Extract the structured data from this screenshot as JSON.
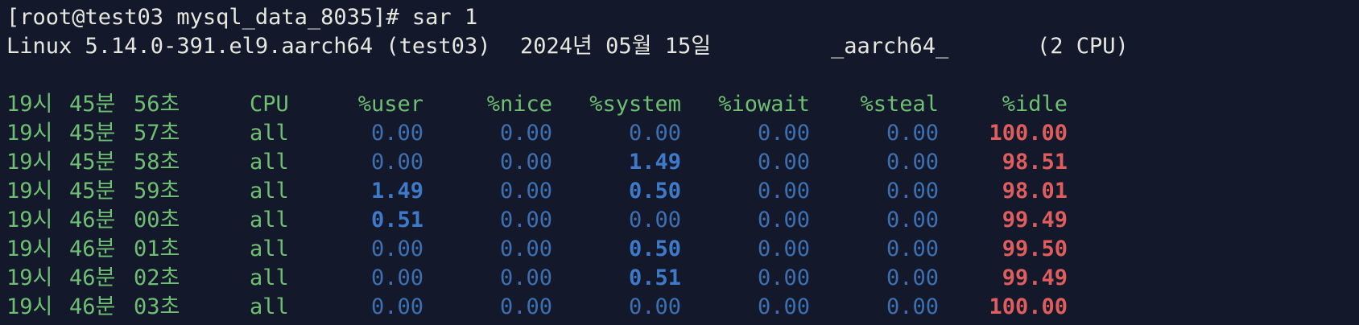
{
  "prompt": "[root@test03 mysql_data_8035]# sar 1",
  "sysinfo": {
    "kernel": "Linux 5.14.0-391.el9.aarch64 (test03)",
    "date": "2024년 05월 15일",
    "arch": "_aarch64_",
    "cpus": "(2 CPU)"
  },
  "header": {
    "h": "19시",
    "m": "45분",
    "s": "56초",
    "cpu": "CPU",
    "user": "%user",
    "nice": "%nice",
    "system": "%system",
    "iowait": "%iowait",
    "steal": "%steal",
    "idle": "%idle"
  },
  "rows": [
    {
      "h": "19시",
      "m": "45분",
      "s": "57초",
      "cpu": "all",
      "user": "0.00",
      "nice": "0.00",
      "system": "0.00",
      "iowait": "0.00",
      "steal": "0.00",
      "idle": "100.00",
      "user_bold": false,
      "system_bold": false
    },
    {
      "h": "19시",
      "m": "45분",
      "s": "58초",
      "cpu": "all",
      "user": "0.00",
      "nice": "0.00",
      "system": "1.49",
      "iowait": "0.00",
      "steal": "0.00",
      "idle": "98.51",
      "user_bold": false,
      "system_bold": true
    },
    {
      "h": "19시",
      "m": "45분",
      "s": "59초",
      "cpu": "all",
      "user": "1.49",
      "nice": "0.00",
      "system": "0.50",
      "iowait": "0.00",
      "steal": "0.00",
      "idle": "98.01",
      "user_bold": true,
      "system_bold": true
    },
    {
      "h": "19시",
      "m": "46분",
      "s": "00초",
      "cpu": "all",
      "user": "0.51",
      "nice": "0.00",
      "system": "0.00",
      "iowait": "0.00",
      "steal": "0.00",
      "idle": "99.49",
      "user_bold": true,
      "system_bold": false
    },
    {
      "h": "19시",
      "m": "46분",
      "s": "01초",
      "cpu": "all",
      "user": "0.00",
      "nice": "0.00",
      "system": "0.50",
      "iowait": "0.00",
      "steal": "0.00",
      "idle": "99.50",
      "user_bold": false,
      "system_bold": true
    },
    {
      "h": "19시",
      "m": "46분",
      "s": "02초",
      "cpu": "all",
      "user": "0.00",
      "nice": "0.00",
      "system": "0.51",
      "iowait": "0.00",
      "steal": "0.00",
      "idle": "99.49",
      "user_bold": false,
      "system_bold": true
    },
    {
      "h": "19시",
      "m": "46분",
      "s": "03초",
      "cpu": "all",
      "user": "0.00",
      "nice": "0.00",
      "system": "0.00",
      "iowait": "0.00",
      "steal": "0.00",
      "idle": "100.00",
      "user_bold": false,
      "system_bold": false
    }
  ],
  "colors": {
    "background": "#13192b",
    "prompt_text": "#e6e8e0",
    "timestamp_green": "#6fbf73",
    "value_blue": "#3e6fb0",
    "value_blue_bold": "#3f79c9",
    "idle_red": "#e05d5d"
  }
}
